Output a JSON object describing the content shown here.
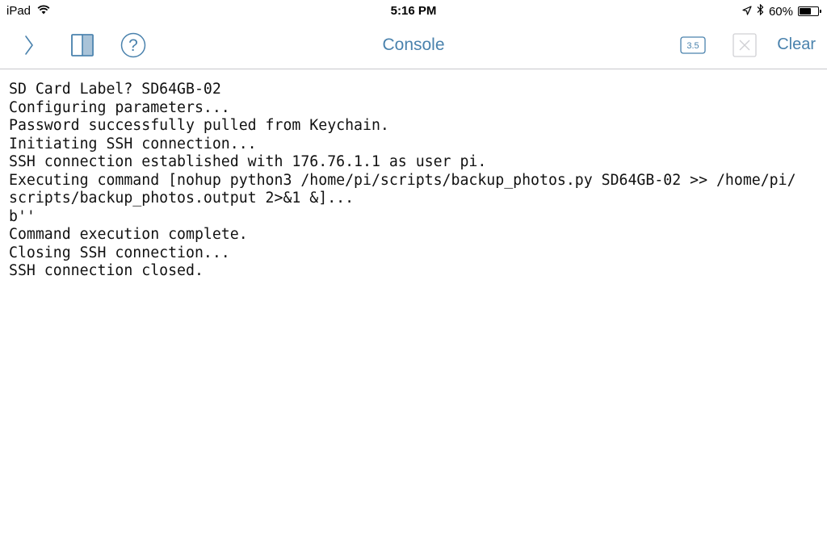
{
  "status_bar": {
    "device": "iPad",
    "time": "5:16 PM",
    "battery_percent": "60%",
    "battery_level": 0.6,
    "icons": [
      "wifi-icon",
      "location-arrow-icon",
      "bluetooth-icon",
      "battery-icon"
    ]
  },
  "nav": {
    "title": "Console",
    "version_badge": "3.5",
    "clear_label": "Clear",
    "icons": [
      "chevron-right-icon",
      "sidebar-panel-icon",
      "help-icon",
      "version-badge-icon",
      "close-icon"
    ],
    "accent_color": "#4a82ad"
  },
  "console": {
    "lines": [
      "SD Card Label? SD64GB-02",
      "Configuring parameters...",
      "Password successfully pulled from Keychain.",
      "Initiating SSH connection...",
      "SSH connection established with 176.76.1.1 as user pi.",
      "Executing command [nohup python3 /home/pi/scripts/backup_photos.py SD64GB-02 >> /home/pi/",
      "scripts/backup_photos.output 2>&1 &]...",
      "b''",
      "Command execution complete.",
      "Closing SSH connection...",
      "SSH connection closed."
    ]
  }
}
